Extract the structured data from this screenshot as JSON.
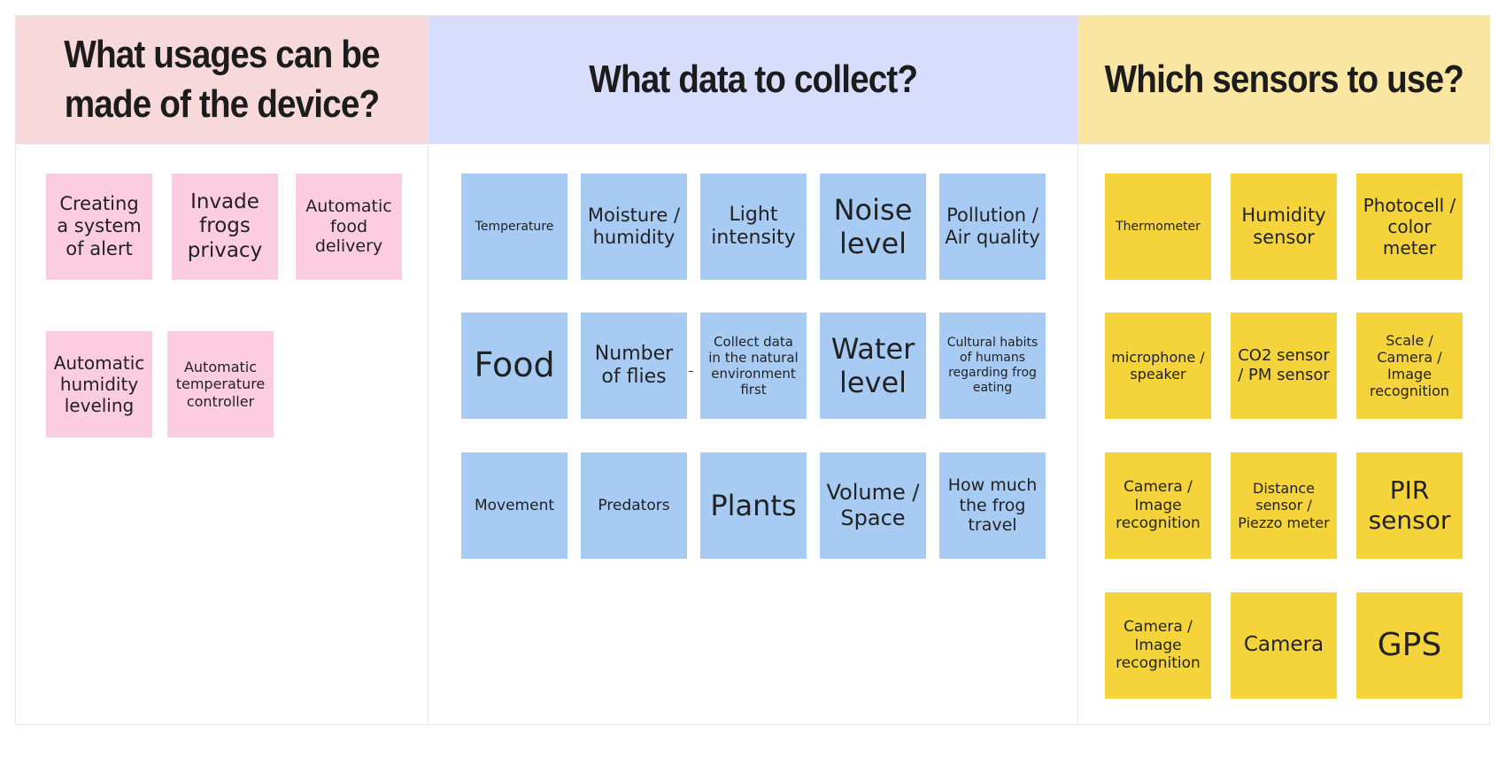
{
  "board": {
    "columns": [
      {
        "id": "usages",
        "title": "What usages can be made of the device?",
        "color": "#f8d9db",
        "sticky_color": "#fccde0",
        "notes": [
          "Creating a system of alert",
          "Invade frogs privacy",
          "Automatic food delivery",
          "Automatic humidity leveling",
          "Automatic temperature controller"
        ]
      },
      {
        "id": "data",
        "title": "What data to collect?",
        "color": "#d8ddfb",
        "sticky_color": "#a7cbf3",
        "notes": [
          "Temperature",
          "Moisture / humidity",
          "Light intensity",
          "Noise level",
          "Pollution / Air quality",
          "Food",
          "Number of flies",
          "Collect data in the natural environment first",
          "Water level",
          "Cultural habits of humans regarding frog eating",
          "Movement",
          "Predators",
          "Plants",
          "Volume / Space",
          "How much the frog travel"
        ]
      },
      {
        "id": "sensors",
        "title": "Which sensors to use?",
        "color": "#f9e6a2",
        "sticky_color": "#f5d33a",
        "notes": [
          "Thermometer",
          "Humidity sensor",
          "Photocell / color meter",
          "microphone / speaker",
          "CO2 sensor / PM sensor",
          "Scale / Camera / Image recognition",
          "Camera / Image recognition",
          "Distance sensor / Piezzo meter",
          "PIR sensor",
          "Camera / Image recognition",
          "Camera",
          "GPS"
        ]
      }
    ]
  }
}
